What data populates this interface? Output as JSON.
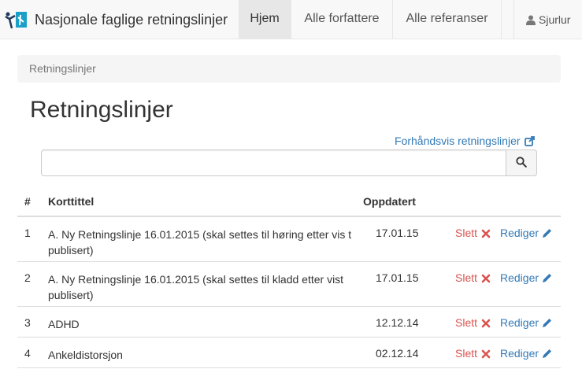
{
  "navbar": {
    "brand": "Nasjonale faglige retningslinjer",
    "items": [
      {
        "label": "Hjem",
        "active": true
      },
      {
        "label": "Alle forfattere",
        "active": false
      },
      {
        "label": "Alle referanser",
        "active": false
      }
    ],
    "user": "Sjurlur"
  },
  "breadcrumb": "Retningslinjer",
  "page_title": "Retningslinjer",
  "preview_link": "Forhåndsvis retningslinjer",
  "search": {
    "value": "",
    "placeholder": ""
  },
  "table": {
    "headers": {
      "num": "#",
      "title": "Korttittel",
      "updated": "Oppdatert"
    },
    "rows": [
      {
        "num": "1",
        "title": "A. Ny Retningslinje 16.01.2015 (skal settes til høring etter vis t publisert)",
        "updated": "17.01.15",
        "delete": "Slett",
        "edit": "Rediger"
      },
      {
        "num": "2",
        "title": "A. Ny Retningslinje 16.01.2015 (skal settes til kladd etter vist publisert)",
        "updated": "17.01.15",
        "delete": "Slett",
        "edit": "Rediger"
      },
      {
        "num": "3",
        "title": "ADHD",
        "updated": "12.12.14",
        "delete": "Slett",
        "edit": "Rediger"
      },
      {
        "num": "4",
        "title": "Ankeldistorsjon",
        "updated": "02.12.14",
        "delete": "Slett",
        "edit": "Rediger"
      }
    ]
  },
  "colors": {
    "link": "#337ab7",
    "danger": "#d9534f",
    "navbar_bg": "#f8f8f8",
    "active_bg": "#e7e7e7"
  }
}
